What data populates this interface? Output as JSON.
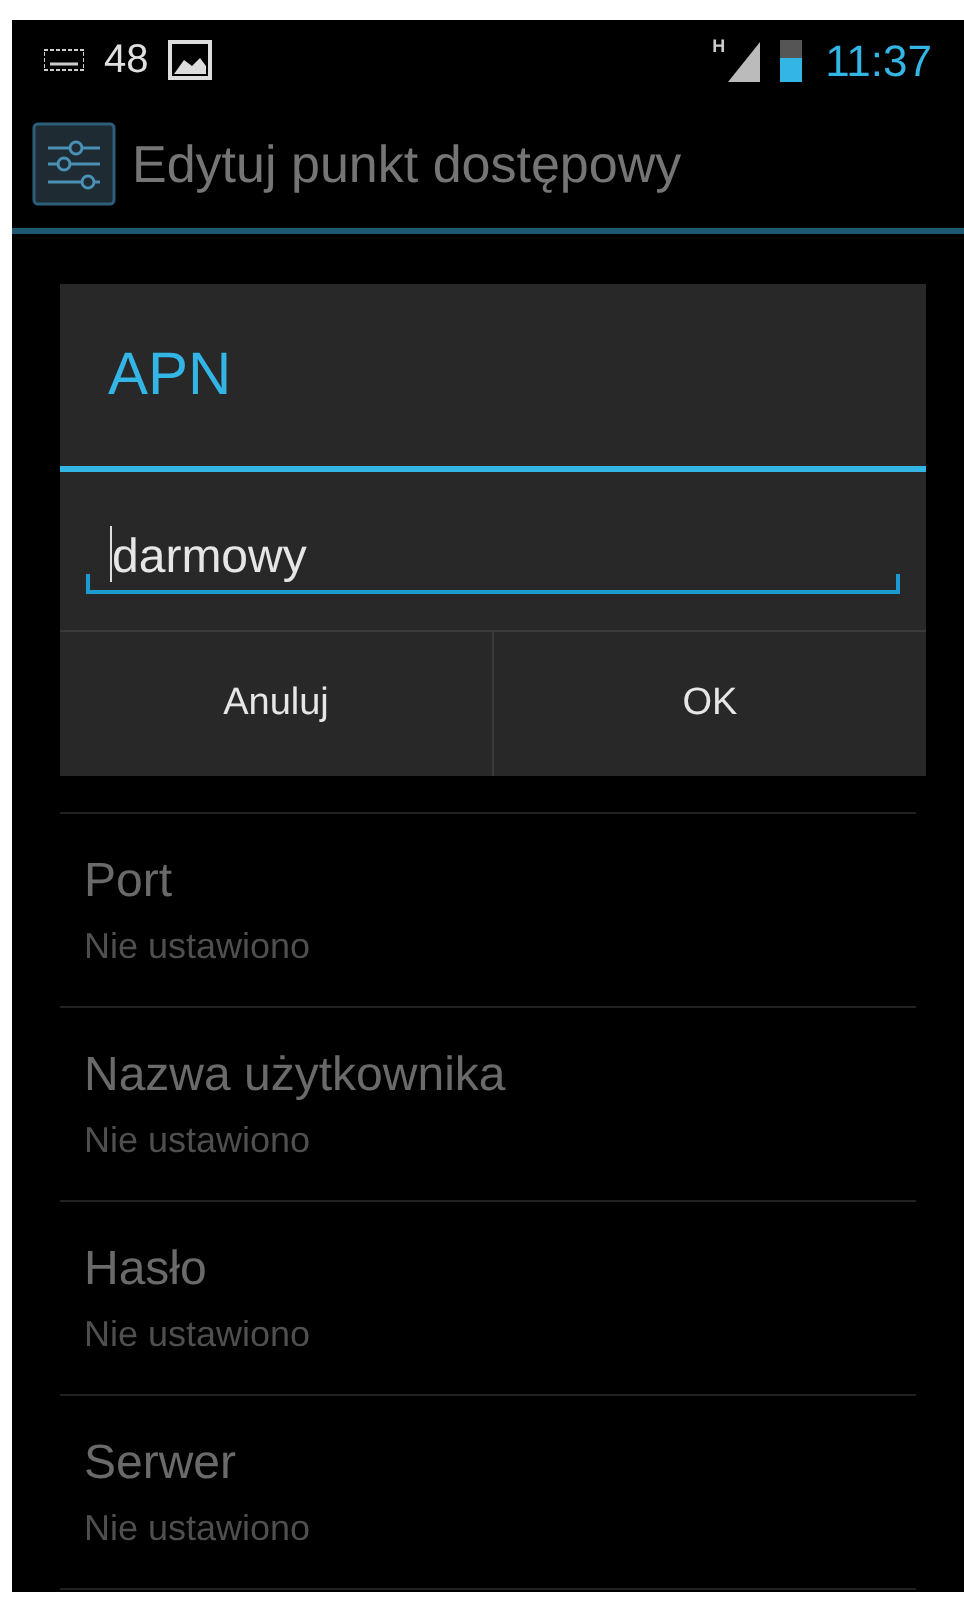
{
  "status_bar": {
    "notification_count": "48",
    "network_type": "H",
    "battery": {
      "level": 0.55
    },
    "time": "11:37"
  },
  "action_bar": {
    "title": "Edytuj punkt dostępowy"
  },
  "settings": [
    {
      "title": "Port",
      "summary": "Nie ustawiono"
    },
    {
      "title": "Nazwa użytkownika",
      "summary": "Nie ustawiono"
    },
    {
      "title": "Hasło",
      "summary": "Nie ustawiono"
    },
    {
      "title": "Serwer",
      "summary": "Nie ustawiono"
    }
  ],
  "dialog": {
    "title": "APN",
    "value": "darmowy",
    "buttons": [
      "Anuluj",
      "OK"
    ]
  }
}
